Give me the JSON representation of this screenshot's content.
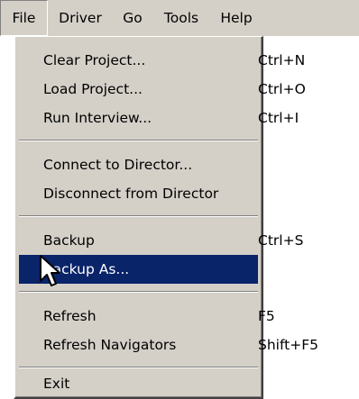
{
  "menubar": {
    "items": [
      {
        "label": "File"
      },
      {
        "label": "Driver"
      },
      {
        "label": "Go"
      },
      {
        "label": "Tools"
      },
      {
        "label": "Help"
      }
    ]
  },
  "file_menu": {
    "items": [
      {
        "label": "Clear Project...",
        "shortcut": "Ctrl+N"
      },
      {
        "label": "Load Project...",
        "shortcut": "Ctrl+O"
      },
      {
        "label": "Run Interview...",
        "shortcut": "Ctrl+I"
      },
      {
        "label": "Connect to Director...",
        "shortcut": ""
      },
      {
        "label": "Disconnect from Director",
        "shortcut": ""
      },
      {
        "label": "Backup",
        "shortcut": "Ctrl+S"
      },
      {
        "label": "Backup As...",
        "shortcut": ""
      },
      {
        "label": "Refresh",
        "shortcut": "F5"
      },
      {
        "label": "Refresh Navigators",
        "shortcut": "Shift+F5"
      },
      {
        "label": "Exit",
        "shortcut": ""
      }
    ],
    "highlighted": "Backup As..."
  },
  "colors": {
    "menu_bg": "#d4d0c8",
    "highlight_bg": "#0a246a",
    "highlight_text": "#ffffff"
  },
  "cursor_icon": "arrow-pointer-icon"
}
